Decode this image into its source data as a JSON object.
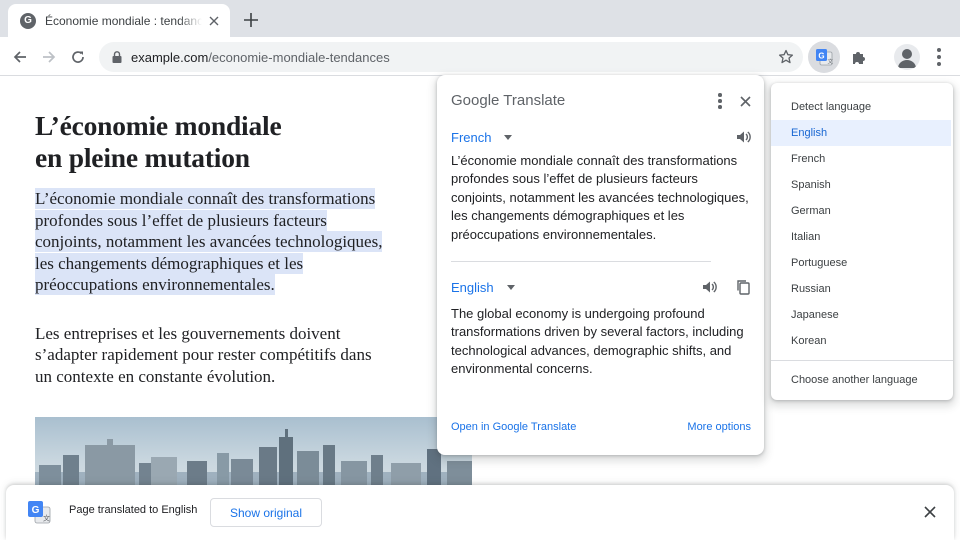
{
  "browser": {
    "tab": {
      "title": "Économie mondiale : tendances et perspectives",
      "favicon_letter": "G"
    },
    "new_tab_label": "+",
    "url": {
      "host": "example.com",
      "path": "/economie-mondiale-tendances"
    },
    "icons": {
      "back": "arrow-left-icon",
      "forward": "arrow-right-icon",
      "reload": "reload-icon",
      "lock": "lock-icon",
      "bookmark": "star-icon",
      "translate": "google-translate-icon",
      "extensions": "puzzle-icon",
      "profile": "avatar-icon",
      "menu": "more-vert-icon"
    }
  },
  "article": {
    "title_line1": "L’économie mondiale",
    "title_line2": "en pleine mutation",
    "paragraph1_lines": [
      "L’économie mondiale connaît des transformations",
      "profondes sous l’effet de plusieurs facteurs",
      "conjoints, notamment les avancées technologiques,",
      "les changements démographiques et les",
      "préoccupations environnementales."
    ],
    "paragraph2_lines": [
      "Les entreprises et les gouvernements doivent",
      "s’adapter rapidement pour rester compétitifs dans",
      "un contexte en constante évolution."
    ]
  },
  "translate_popup": {
    "logo_google": "Google",
    "logo_translate": "Translate",
    "source_language": "French",
    "source_text": "L’économie mondiale connaît des transformations profondes sous l’effet de plusieurs facteurs conjoints, notamment les avancées technologiques, les changements démographiques et les préoccupations environnementales.",
    "target_language": "English",
    "target_text": "The global economy is undergoing profound transformations driven by several factors, including technological advances, demographic shifts, and environmental concerns.",
    "open_link": "Open in Google Translate",
    "more_options": "More options"
  },
  "language_menu": {
    "items": [
      "Detect language",
      "English",
      "French",
      "Spanish",
      "German",
      "Italian",
      "Portuguese",
      "Russian",
      "Japanese",
      "Korean"
    ],
    "selected": "English",
    "footer": "Choose another language"
  },
  "infobar": {
    "message": "Page translated to English",
    "show_original": "Show original"
  },
  "colors": {
    "accent": "#1a73e8",
    "highlight": "#dbe4f7",
    "selected_bg": "#e8f0fe",
    "chrome_bg": "#dee1e6"
  }
}
